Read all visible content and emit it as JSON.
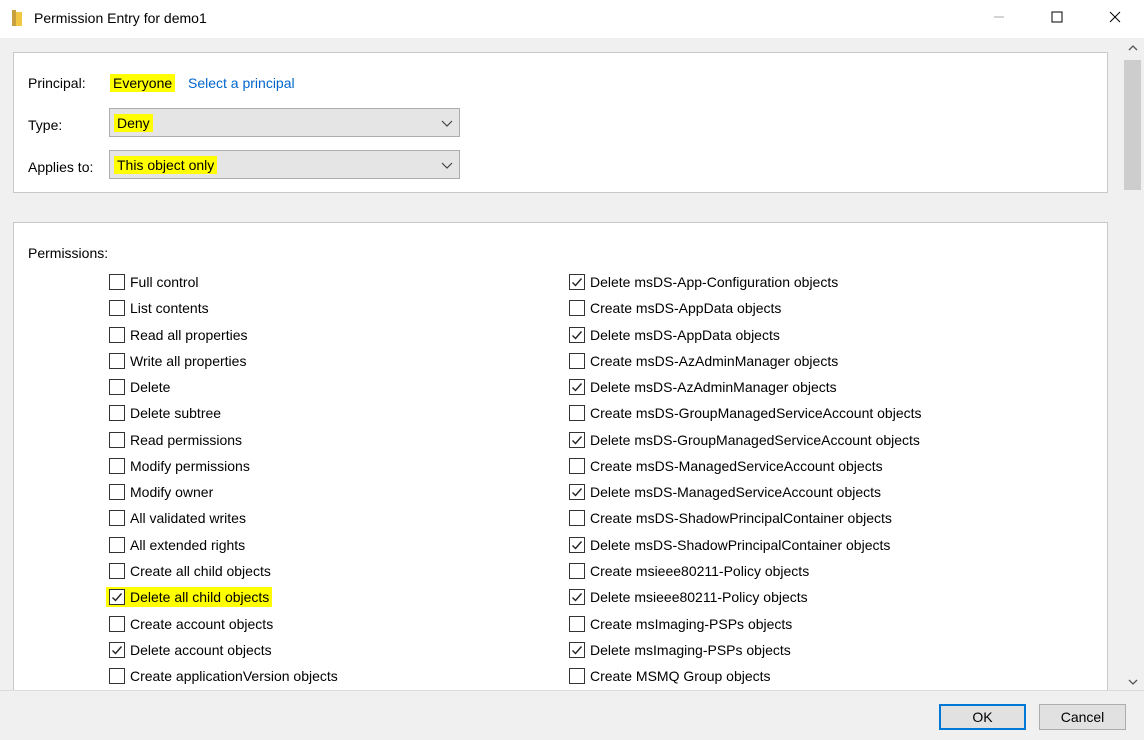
{
  "window": {
    "title": "Permission Entry for demo1",
    "icon": "folder-icon"
  },
  "principal": {
    "label": "Principal:",
    "value": "Everyone",
    "link": "Select a principal"
  },
  "type": {
    "label": "Type:",
    "value": "Deny"
  },
  "applies_to": {
    "label": "Applies to:",
    "value": "This object only"
  },
  "permissions": {
    "label": "Permissions:",
    "left": [
      {
        "label": "Full control",
        "checked": false
      },
      {
        "label": "List contents",
        "checked": false
      },
      {
        "label": "Read all properties",
        "checked": false
      },
      {
        "label": "Write all properties",
        "checked": false
      },
      {
        "label": "Delete",
        "checked": false
      },
      {
        "label": "Delete subtree",
        "checked": false
      },
      {
        "label": "Read permissions",
        "checked": false
      },
      {
        "label": "Modify permissions",
        "checked": false
      },
      {
        "label": "Modify owner",
        "checked": false
      },
      {
        "label": "All validated writes",
        "checked": false
      },
      {
        "label": "All extended rights",
        "checked": false
      },
      {
        "label": "Create all child objects",
        "checked": false
      },
      {
        "label": "Delete all child objects",
        "checked": true,
        "highlighted": true
      },
      {
        "label": "Create account objects",
        "checked": false
      },
      {
        "label": "Delete account objects",
        "checked": true
      },
      {
        "label": "Create applicationVersion objects",
        "checked": false
      }
    ],
    "right": [
      {
        "label": "Delete msDS-App-Configuration objects",
        "checked": true
      },
      {
        "label": "Create msDS-AppData objects",
        "checked": false
      },
      {
        "label": "Delete msDS-AppData objects",
        "checked": true
      },
      {
        "label": "Create msDS-AzAdminManager objects",
        "checked": false
      },
      {
        "label": "Delete msDS-AzAdminManager objects",
        "checked": true
      },
      {
        "label": "Create msDS-GroupManagedServiceAccount objects",
        "checked": false
      },
      {
        "label": "Delete msDS-GroupManagedServiceAccount objects",
        "checked": true
      },
      {
        "label": "Create msDS-ManagedServiceAccount objects",
        "checked": false
      },
      {
        "label": "Delete msDS-ManagedServiceAccount objects",
        "checked": true
      },
      {
        "label": "Create msDS-ShadowPrincipalContainer objects",
        "checked": false
      },
      {
        "label": "Delete msDS-ShadowPrincipalContainer objects",
        "checked": true
      },
      {
        "label": "Create msieee80211-Policy objects",
        "checked": false
      },
      {
        "label": "Delete msieee80211-Policy objects",
        "checked": true
      },
      {
        "label": "Create msImaging-PSPs objects",
        "checked": false
      },
      {
        "label": "Delete msImaging-PSPs objects",
        "checked": true
      },
      {
        "label": "Create MSMQ Group objects",
        "checked": false
      }
    ]
  },
  "buttons": {
    "ok": "OK",
    "cancel": "Cancel"
  },
  "colors": {
    "highlight": "#ffff00",
    "link": "#0066cc",
    "default_button_border": "#0078d7"
  }
}
